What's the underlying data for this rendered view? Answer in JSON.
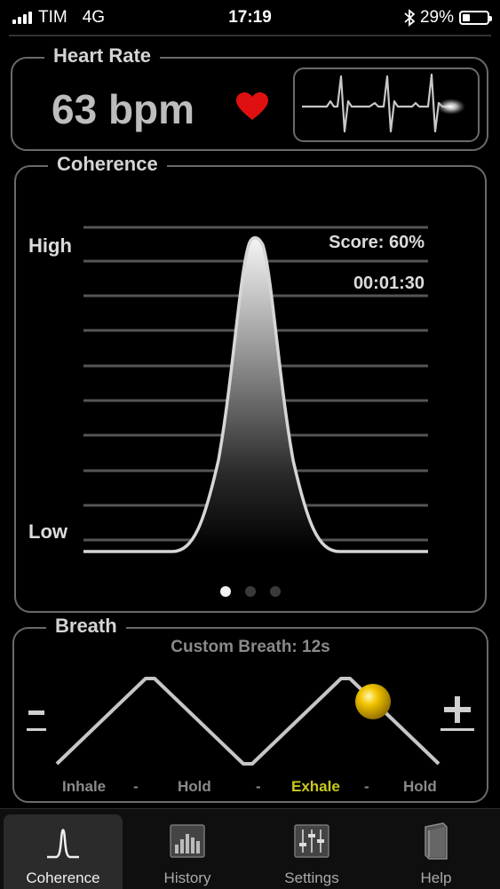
{
  "status_bar": {
    "carrier": "TIM",
    "network": "4G",
    "time": "17:19",
    "battery": "29%",
    "battery_level": 0.29
  },
  "heart_rate": {
    "title": "Heart Rate",
    "value": "63 bpm",
    "heart_color": "#e01010"
  },
  "coherence": {
    "title": "Coherence",
    "high_label": "High",
    "low_label": "Low",
    "score_text": "Score:  60%",
    "timer": "00:01:30",
    "pages": 3,
    "active_page": 0
  },
  "breath": {
    "title": "Breath",
    "subtitle": "Custom Breath: 12s",
    "minus": "−",
    "plus": "+",
    "phases": [
      "Inhale",
      "-",
      "Hold",
      "-",
      "Exhale",
      "-",
      "Hold"
    ],
    "active_phase": "Exhale",
    "active_color": "#c8c820"
  },
  "tabs": [
    {
      "label": "Coherence",
      "icon": "coherence-icon",
      "active": true
    },
    {
      "label": "History",
      "icon": "history-icon",
      "active": false
    },
    {
      "label": "Settings",
      "icon": "settings-icon",
      "active": false
    },
    {
      "label": "Help",
      "icon": "help-icon",
      "active": false
    }
  ]
}
